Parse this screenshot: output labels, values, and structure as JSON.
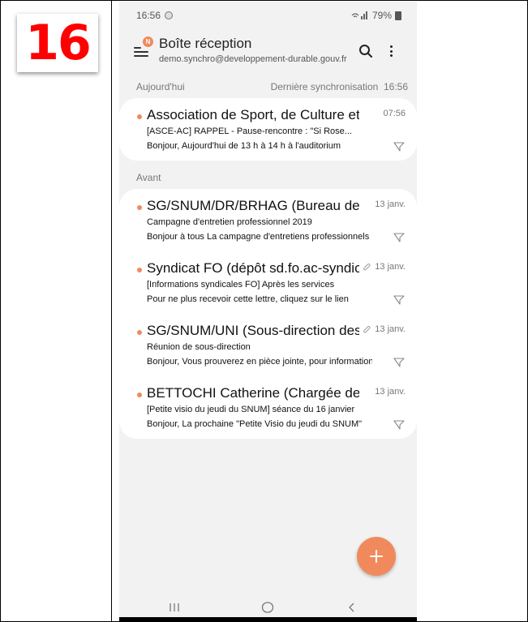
{
  "step_number": "16",
  "status_bar": {
    "time": "16:56",
    "battery": "79%"
  },
  "header": {
    "title": "Boîte réception",
    "account": "demo.synchro@developpement-durable.gouv.fr",
    "menu_badge": "N"
  },
  "sections": {
    "today_label": "Aujourd'hui",
    "sync_label": "Dernière synchronisation",
    "sync_time": "16:56",
    "before_label": "Avant"
  },
  "today_emails": [
    {
      "sender": "Association de Sport, de Culture et d'Action Civique",
      "date": "07:56",
      "subject": "[ASCE-AC] RAPPEL - Pause-rencontre : \"Si Rose...",
      "preview": "Bonjour, Aujourd'hui de 13 h à 14 h à l'auditorium",
      "has_attachment": false
    }
  ],
  "older_emails": [
    {
      "sender": "SG/SNUM/DR/BRHAG (Bureau des ressources humaines)",
      "date": "13 janv.",
      "subject": "Campagne d'entretien professionnel 2019",
      "preview": "Bonjour à tous La campagne d'entretiens professionnels",
      "has_attachment": false
    },
    {
      "sender": "Syndicat FO (dépôt sd.fo.ac-syndicat)",
      "date": "13 janv.",
      "subject": "[Informations syndicales FO] Après les services",
      "preview": "Pour ne plus recevoir cette lettre, cliquez sur le lien",
      "has_attachment": true
    },
    {
      "sender": "SG/SNUM/UNI (Sous-direction des usages)",
      "date": "13 janv.",
      "subject": "Réunion de sous-direction",
      "preview": "Bonjour, Vous prouverez en pièce jointe, pour information",
      "has_attachment": true
    },
    {
      "sender": "BETTOCHI Catherine (Chargée de mission)",
      "date": "13 janv.",
      "subject": "[Petite visio du jeudi du SNUM] séance du 16 janvier",
      "preview": "Bonjour, La prochaine \"Petite Visio du jeudi du SNUM\"",
      "has_attachment": false
    }
  ],
  "icons": {
    "menu": "hamburger-menu-icon",
    "search": "search-icon",
    "more": "more-vertical-icon",
    "flag": "flag-outline-icon",
    "attachment": "paperclip-icon",
    "compose": "plus-icon",
    "recent_apps": "recent-apps-icon",
    "home": "home-icon",
    "back": "back-icon"
  },
  "colors": {
    "accent": "#f08a5d",
    "step_number": "#ff0000",
    "background": "#f2f2f2",
    "card": "#ffffff"
  }
}
